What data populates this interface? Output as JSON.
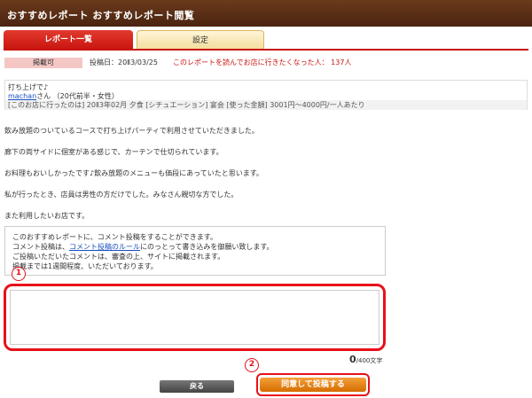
{
  "header": {
    "title": "おすすめレポート おすすめレポート閲覧"
  },
  "tabs": [
    {
      "label": "レポート一覧"
    },
    {
      "label": "設定"
    }
  ],
  "info": {
    "status": "掲載可",
    "posted_date": "投稿日：20Ⅱ3/03/25",
    "want_to_visit": "このレポートを読んでお店に行きたくなった人：  137人"
  },
  "report": {
    "title": "打ち上げで♪",
    "user_name": "machan",
    "user_suffix": "さん （20代前半・女性）",
    "meta": "[このお店に行ったのは] 20Ⅱ3年02月 夕食    [シチュエーション] 宴会    [使った金額] 3001円〜4000円/一人あたり"
  },
  "body_lines": [
    "飲み放題のついているコースで打ち上げパーティで利用させていただきました。",
    "廊下の両サイドに個室がある感じで、カーテンで仕切られています。",
    "お料理もおいしかったです♪飲み放題のメニューも価段にあっていたと思います。",
    "私が行ったとき、店員は男性の方だけでした。みなさん親切な方でした。",
    "また利用したいお店です。"
  ],
  "notice": {
    "line1": "このおすすめレポートに、コメント投稿をすることができます。",
    "line2_prefix": "コメント投稿は、",
    "line2_link": "コメント投稿のルール",
    "line2_suffix": "にのっとって書き込みを御願い致します。",
    "line3": "ご投稿いただいたコメントは、審査の上、サイトに掲載されます。",
    "line4": "掲載までは1週間程度、いただいております。"
  },
  "markers": {
    "one": "1",
    "two": "2"
  },
  "comment": {
    "value": "",
    "count": "0",
    "limit": "/400文字"
  },
  "buttons": {
    "back": "戻る",
    "submit": "同意して投稿する"
  }
}
